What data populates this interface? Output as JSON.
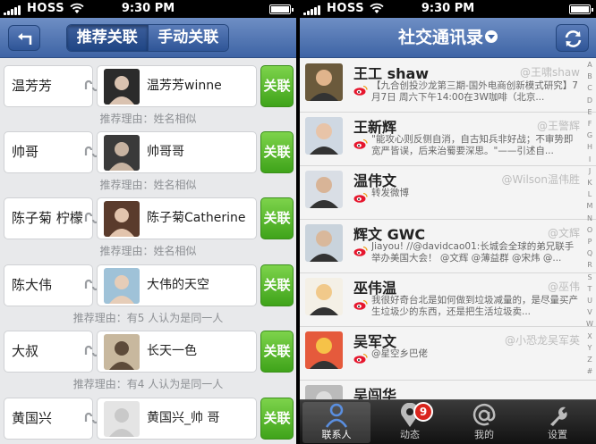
{
  "status": {
    "carrier": "HOSS",
    "time": "9:30 PM"
  },
  "left": {
    "segments": [
      {
        "label": "推荐关联",
        "active": true
      },
      {
        "label": "手动关联",
        "active": false
      }
    ],
    "link_label": "关联",
    "matches": [
      {
        "contact": "温芳芳",
        "weibo": "温芳芳winne",
        "reason": "推荐理由：姓名相似"
      },
      {
        "contact": "帅哥",
        "weibo": "帅哥哥",
        "reason": "推荐理由：姓名相似"
      },
      {
        "contact": "陈子菊 柠檬",
        "weibo": "陈子菊Catherine",
        "reason": "推荐理由：姓名相似"
      },
      {
        "contact": "陈大伟",
        "weibo": "大伟的天空",
        "reason": "推荐理由：有5 人认为是同一人"
      },
      {
        "contact": "大叔",
        "weibo": "长天一色",
        "reason": "推荐理由：有4 人认为是同一人"
      },
      {
        "contact": "黄国兴",
        "weibo": "黄国兴_帅 哥",
        "reason": ""
      }
    ]
  },
  "right": {
    "title": "社交通讯录",
    "contacts": [
      {
        "name": "王工 shaw",
        "handle": "@王啸shaw",
        "snippet": "【九合创投沙龙第三期-国外电商创新模式研究】7月7日 周六下午14:00在3W咖啡（北京..."
      },
      {
        "name": "王新辉",
        "handle": "@王警辉",
        "snippet": "\"能攻心则反侧自消，自古知兵非好战；不审势即宽严皆误，后来治蜀要深思。\"——引述自..."
      },
      {
        "name": "温伟文",
        "handle": "@Wilson温伟胜",
        "snippet": "转发微博"
      },
      {
        "name": "辉文 GWC",
        "handle": "@文辉",
        "snippet": "Jiayou! //@davidcao01:长城会全球的弟兄联手举办美国大会！ @文辉 @薄益群 @宋炜 @..."
      },
      {
        "name": "巫伟温",
        "handle": "@巫伟",
        "snippet": "我很好奇台北是如何做到垃圾减量的，是尽量买产生垃圾少的东西，还是把生活垃圾卖..."
      },
      {
        "name": "吴军文",
        "handle": "@小恐龙吴军英",
        "snippet": "@星空乡巴佬"
      },
      {
        "name": "吴闯华",
        "handle": "",
        "snippet": ""
      }
    ],
    "index_letters": [
      "A",
      "B",
      "C",
      "D",
      "E",
      "F",
      "G",
      "H",
      "I",
      "J",
      "K",
      "L",
      "M",
      "N",
      "O",
      "P",
      "Q",
      "R",
      "S",
      "T",
      "U",
      "V",
      "W",
      "X",
      "Y",
      "Z",
      "#"
    ],
    "tabs": [
      {
        "label": "联系人",
        "icon": "person-icon",
        "active": true
      },
      {
        "label": "动态",
        "icon": "location-pin-icon",
        "active": false,
        "badge": "9"
      },
      {
        "label": "我的",
        "icon": "at-icon",
        "active": false
      },
      {
        "label": "设置",
        "icon": "wrench-icon",
        "active": false
      }
    ]
  },
  "colors": {
    "nav_blue": "#3e64a5",
    "link_green": "#4fb826",
    "badge_red": "#d9251d",
    "weibo_red": "#e6162d"
  }
}
